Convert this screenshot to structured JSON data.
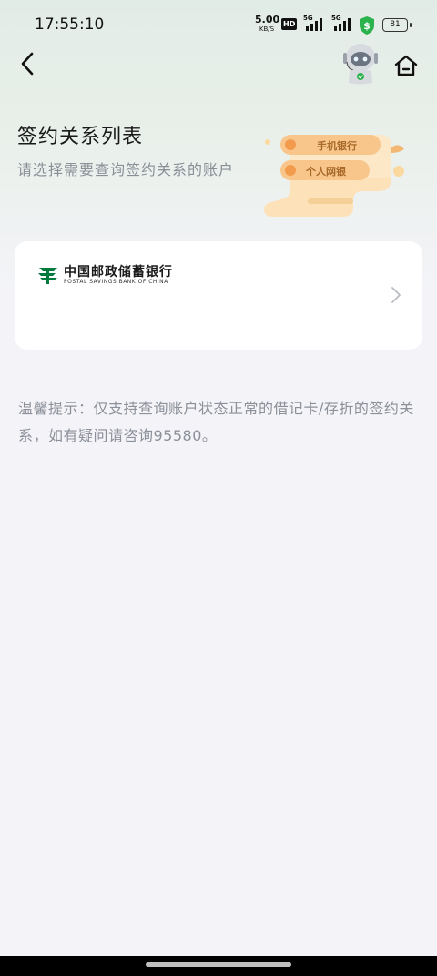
{
  "status_bar": {
    "time": "17:55:10",
    "net_speed_value": "5.00",
    "net_speed_unit": "KB/S",
    "hd_label": "HD",
    "signal1_label": "5G",
    "signal2_label": "5G",
    "battery_level": "81"
  },
  "nav": {
    "back_icon": "chevron-left-icon",
    "assistant_icon": "robot-icon",
    "home_icon": "home-icon"
  },
  "header": {
    "title": "签约关系列表",
    "subtitle": "请选择需要查询签约关系的账户"
  },
  "banner": {
    "pill1": "手机银行",
    "pill2": "个人网银"
  },
  "account_card": {
    "bank_name_cn": "中国邮政储蓄银行",
    "bank_name_en": "POSTAL SAVINGS BANK OF CHINA"
  },
  "tip": {
    "text": "温馨提示：仅支持查询账户状态正常的借记卡/存折的签约关系，如有疑问请咨询95580。"
  },
  "colors": {
    "brand_green": "#007a3d",
    "shield_green": "#2bb24c",
    "banner_orange": "#f8c58a"
  }
}
